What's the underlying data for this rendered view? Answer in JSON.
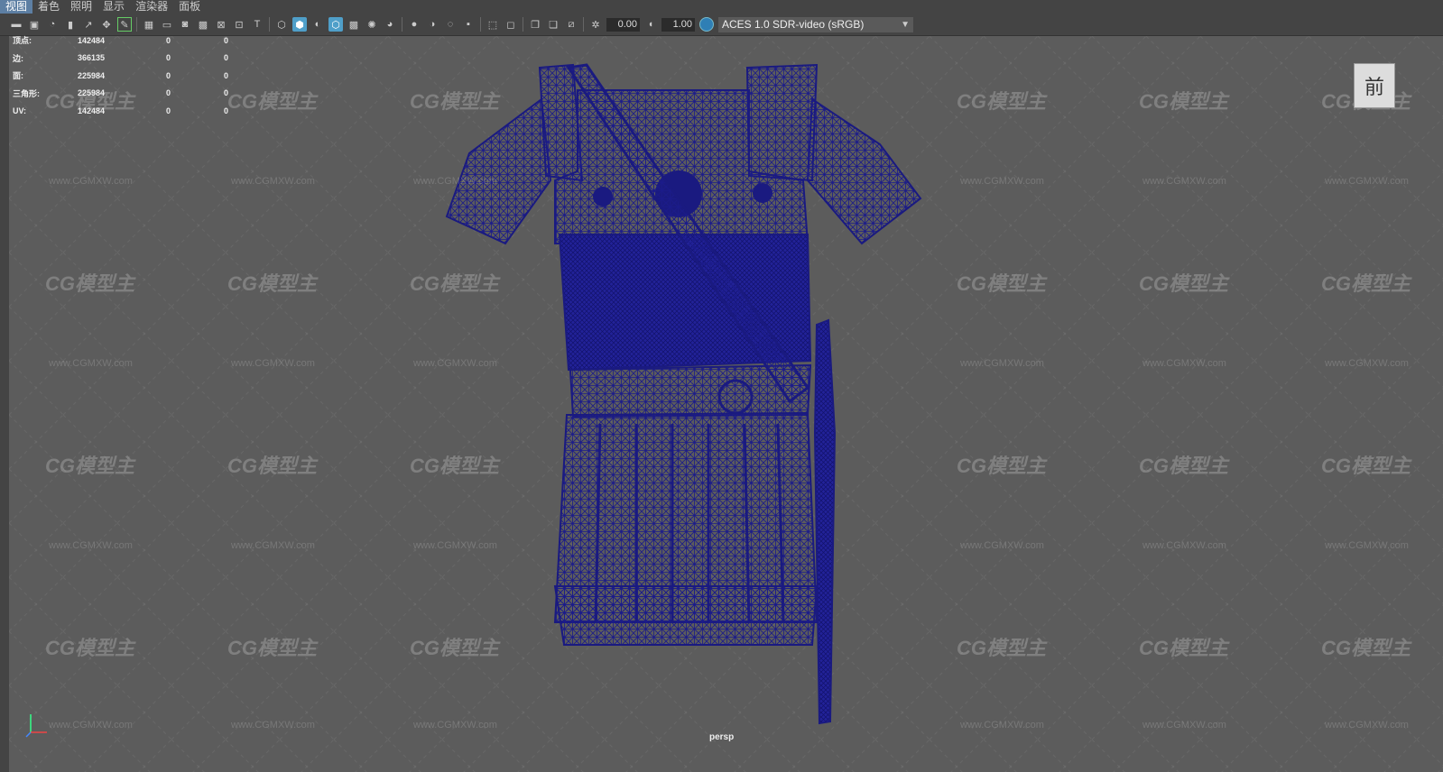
{
  "menu": [
    "视图",
    "着色",
    "照明",
    "显示",
    "渲染器",
    "面板"
  ],
  "toolbar": {
    "exposure": "0.00",
    "gamma": "1.00",
    "color_space": "ACES 1.0 SDR-video (sRGB)"
  },
  "stats": [
    {
      "label": "顶点:",
      "v1": "142484",
      "v2": "0",
      "v3": "0"
    },
    {
      "label": "边:",
      "v1": "366135",
      "v2": "0",
      "v3": "0"
    },
    {
      "label": "面:",
      "v1": "225984",
      "v2": "0",
      "v3": "0"
    },
    {
      "label": "三角形:",
      "v1": "225984",
      "v2": "0",
      "v3": "0"
    },
    {
      "label": "UV:",
      "v1": "142484",
      "v2": "0",
      "v3": "0"
    }
  ],
  "viewcube_label": "前",
  "camera_label": "persp",
  "watermark": {
    "logo": "CG模型主",
    "url": "www.CGMXW.com"
  },
  "colors": {
    "viewport": "#5c5c5c",
    "wireframe": "#1a1a80",
    "accent": "#5d7fa3"
  }
}
